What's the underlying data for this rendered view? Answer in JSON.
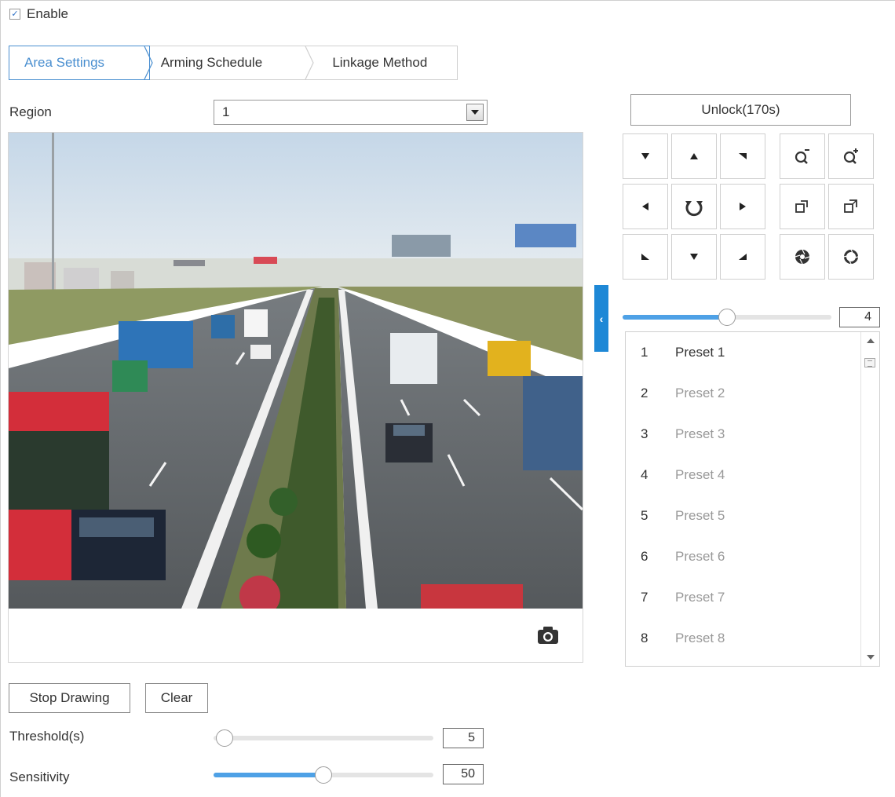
{
  "enable": {
    "label": "Enable",
    "checked": true
  },
  "tabs": [
    {
      "label": "Area Settings",
      "active": true
    },
    {
      "label": "Arming Schedule",
      "active": false
    },
    {
      "label": "Linkage Method",
      "active": false
    }
  ],
  "region": {
    "label": "Region",
    "value": "1"
  },
  "ptz": {
    "unlock_label": "Unlock(170s)",
    "speed_value": "4",
    "speed_fraction": 0.5
  },
  "presets": [
    {
      "num": "1",
      "name": "Preset 1",
      "selected": true
    },
    {
      "num": "2",
      "name": "Preset 2"
    },
    {
      "num": "3",
      "name": "Preset 3"
    },
    {
      "num": "4",
      "name": "Preset 4"
    },
    {
      "num": "5",
      "name": "Preset 5"
    },
    {
      "num": "6",
      "name": "Preset 6"
    },
    {
      "num": "7",
      "name": "Preset 7"
    },
    {
      "num": "8",
      "name": "Preset 8"
    }
  ],
  "buttons": {
    "stop_drawing": "Stop Drawing",
    "clear": "Clear"
  },
  "threshold": {
    "label": "Threshold(s)",
    "value": "5",
    "fraction": 0.0
  },
  "sensitivity": {
    "label": "Sensitivity",
    "value": "50",
    "fraction": 0.5
  },
  "colors": {
    "accent": "#4a8fd0",
    "slider_fill": "#4ea1e6",
    "collapse_tab": "#1e88d6"
  }
}
